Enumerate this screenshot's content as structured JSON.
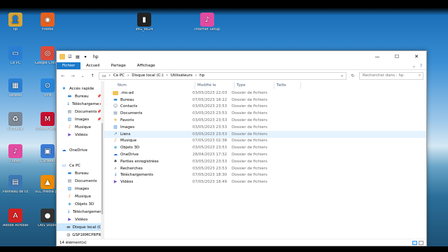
{
  "desktop": {
    "icons": [
      {
        "label": "hp",
        "icon": "user-folder-icon",
        "color": "#d4a53a"
      },
      {
        "label": "Firefox",
        "icon": "firefox-icon",
        "color": "#e8601c"
      },
      {
        "label": "Ce PC",
        "icon": "computer-icon",
        "color": "#2a7fd4"
      },
      {
        "label": "Google Chrome",
        "icon": "chrome-icon",
        "color": "#dd4b39"
      },
      {
        "label": "Réseau",
        "icon": "network-icon",
        "color": "#2a7fd4"
      },
      {
        "label": "VPN",
        "icon": "vpn-icon",
        "color": "#2a88dd"
      },
      {
        "label": "Corbeille",
        "icon": "recycle-bin-icon",
        "color": "#7a8896"
      },
      {
        "label": "McAfee Secu Scan Plus",
        "icon": "mcafee-icon",
        "color": "#c8102e"
      },
      {
        "label": "iTunes",
        "icon": "itunes-icon",
        "color": "#e24aa0"
      },
      {
        "label": "CSHaker",
        "icon": "app-icon",
        "color": "#3a7bd5"
      },
      {
        "label": "Panneau de configuration",
        "icon": "control-panel-icon",
        "color": "#3c78b4"
      },
      {
        "label": "VLC media player",
        "icon": "vlc-icon",
        "color": "#f08c00"
      },
      {
        "label": "Adobe Acrobat",
        "icon": "acrobat-icon",
        "color": "#d42020"
      },
      {
        "label": "OBS Studio",
        "icon": "obs-icon",
        "color": "#333333"
      },
      {
        "label": "IMG_6624",
        "icon": "image-file-icon",
        "color": "#222222"
      },
      {
        "label": "Internet Setup",
        "icon": "setup-icon",
        "color": "#e24aa0"
      }
    ]
  },
  "window": {
    "title": "hp",
    "ribbon_tabs": [
      "Fichier",
      "Accueil",
      "Partage",
      "Affichage"
    ],
    "active_tab": "Fichier",
    "address": {
      "segments": [
        "Ce PC",
        "Disque local (C:)",
        "Utilisateurs",
        "hp"
      ],
      "search_placeholder": "Rechercher dans : hp"
    },
    "nav_pane": [
      {
        "label": "Accès rapide",
        "icon": "star-icon",
        "pinned": false,
        "level": 0,
        "selected": false
      },
      {
        "label": "Bureau",
        "icon": "desktop-icon",
        "pinned": true,
        "level": 1,
        "selected": false
      },
      {
        "label": "Téléchargeme",
        "icon": "download-icon",
        "pinned": true,
        "level": 1,
        "selected": false
      },
      {
        "label": "Documents",
        "icon": "documents-icon",
        "pinned": true,
        "level": 1,
        "selected": false
      },
      {
        "label": "Images",
        "icon": "images-icon",
        "pinned": true,
        "level": 1,
        "selected": false
      },
      {
        "label": "Musique",
        "icon": "music-icon",
        "pinned": false,
        "level": 1,
        "selected": false
      },
      {
        "label": "Vidéos",
        "icon": "videos-icon",
        "pinned": false,
        "level": 1,
        "selected": false
      },
      {
        "label": "",
        "icon": "",
        "pinned": false,
        "level": 0,
        "selected": false
      },
      {
        "label": "OneDrive",
        "icon": "onedrive-icon",
        "pinned": false,
        "level": 0,
        "selected": false
      },
      {
        "label": "",
        "icon": "",
        "pinned": false,
        "level": 0,
        "selected": false
      },
      {
        "label": "Ce PC",
        "icon": "computer-icon",
        "pinned": false,
        "level": 0,
        "selected": false
      },
      {
        "label": "Bureau",
        "icon": "desktop-icon",
        "pinned": false,
        "level": 1,
        "selected": false
      },
      {
        "label": "Documents",
        "icon": "documents-icon",
        "pinned": false,
        "level": 1,
        "selected": false
      },
      {
        "label": "Images",
        "icon": "images-icon",
        "pinned": false,
        "level": 1,
        "selected": false
      },
      {
        "label": "Musique",
        "icon": "music-icon",
        "pinned": false,
        "level": 1,
        "selected": false
      },
      {
        "label": "Objets 3D",
        "icon": "objects3d-icon",
        "pinned": false,
        "level": 1,
        "selected": false
      },
      {
        "label": "Téléchargement",
        "icon": "download-icon",
        "pinned": false,
        "level": 1,
        "selected": false
      },
      {
        "label": "Vidéos",
        "icon": "videos-icon",
        "pinned": false,
        "level": 1,
        "selected": false
      },
      {
        "label": "Disque local (C:)",
        "icon": "drive-icon",
        "pinned": false,
        "level": 1,
        "selected": true
      },
      {
        "label": "GSP1RMCPRFR (",
        "icon": "dvd-drive-icon",
        "pinned": false,
        "level": 1,
        "selected": false
      }
    ],
    "columns": {
      "name": "Nom",
      "date": "Modifié le",
      "type": "Type",
      "size": "Taille"
    },
    "files": [
      {
        "name": ".ms-ad",
        "date": "03/05/2023 22:03",
        "type": "Dossier de fichiers",
        "icon": "folder-icon",
        "selected": false
      },
      {
        "name": "Bureau",
        "date": "07/05/2023 18:22",
        "type": "Dossier de fichiers",
        "icon": "desktop-folder-icon",
        "selected": false
      },
      {
        "name": "Contacts",
        "date": "03/05/2023 23:53",
        "type": "Dossier de fichiers",
        "icon": "contacts-icon",
        "selected": false
      },
      {
        "name": "Documents",
        "date": "03/05/2023 23:53",
        "type": "Dossier de fichiers",
        "icon": "documents-icon",
        "selected": false
      },
      {
        "name": "Favoris",
        "date": "03/05/2023 23:53",
        "type": "Dossier de fichiers",
        "icon": "favorites-icon",
        "selected": false
      },
      {
        "name": "Images",
        "date": "03/05/2023 23:53",
        "type": "Dossier de fichiers",
        "icon": "images-icon",
        "selected": false
      },
      {
        "name": "Liens",
        "date": "03/05/2023 23:53",
        "type": "Dossier de fichiers",
        "icon": "links-icon",
        "selected": true
      },
      {
        "name": "Musique",
        "date": "07/05/2023 02:38",
        "type": "Dossier de fichiers",
        "icon": "music-icon",
        "selected": false
      },
      {
        "name": "Objets 3D",
        "date": "03/05/2023 23:53",
        "type": "Dossier de fichiers",
        "icon": "objects3d-icon",
        "selected": false
      },
      {
        "name": "OneDrive",
        "date": "28/04/2023 17:32",
        "type": "Dossier de fichiers",
        "icon": "onedrive-icon",
        "selected": false
      },
      {
        "name": "Parties enregistrées",
        "date": "03/05/2023 23:53",
        "type": "Dossier de fichiers",
        "icon": "saved-games-icon",
        "selected": false
      },
      {
        "name": "Recherches",
        "date": "03/05/2023 23:53",
        "type": "Dossier de fichiers",
        "icon": "searches-icon",
        "selected": false
      },
      {
        "name": "Téléchargements",
        "date": "07/05/2023 18:30",
        "type": "Dossier de fichiers",
        "icon": "download-icon",
        "selected": false
      },
      {
        "name": "Vidéos",
        "date": "07/05/2023 18:49",
        "type": "Dossier de fichiers",
        "icon": "videos-icon",
        "selected": false
      }
    ],
    "status": "14 élément(s)"
  },
  "colors": {
    "accent": "#1979ca",
    "folder": "#f2c45a",
    "selection": "#cce8ff"
  }
}
